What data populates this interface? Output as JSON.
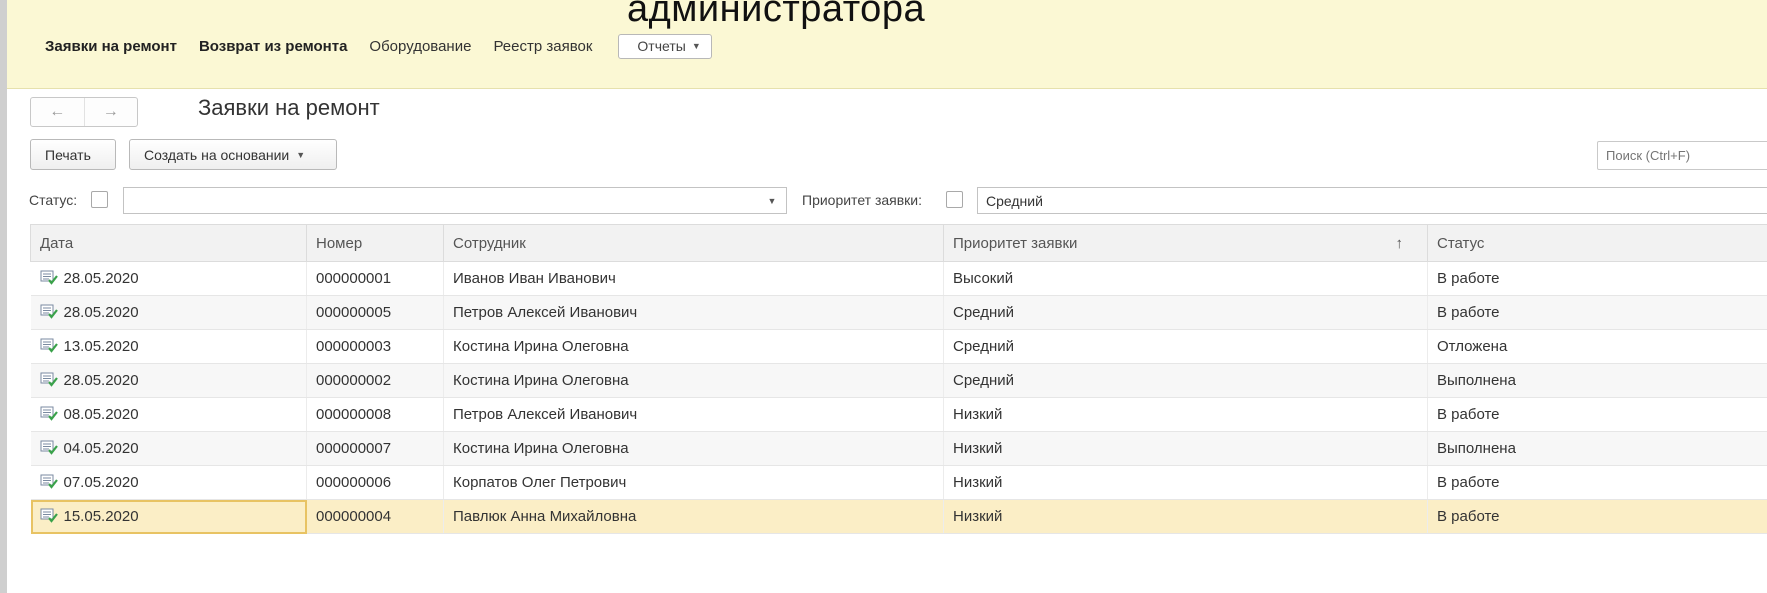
{
  "overlay_title": "администратора",
  "nav": {
    "items": [
      "Заявки на ремонт",
      "Возврат из ремонта",
      "Оборудование",
      "Реестр заявок"
    ],
    "reports": "Отчеты"
  },
  "navigation": {
    "back": "←",
    "forward": "→"
  },
  "page_title": "Заявки на ремонт",
  "toolbar": {
    "print": "Печать",
    "create_based_on": "Создать на основании"
  },
  "search": {
    "placeholder": "Поиск (Ctrl+F)"
  },
  "filters": {
    "status_label": "Статус:",
    "status_value": "",
    "priority_label": "Приоритет заявки:",
    "priority_value": "Средний"
  },
  "table": {
    "columns": [
      "Дата",
      "Номер",
      "Сотрудник",
      "Приоритет заявки",
      "Статус"
    ],
    "sort_indicator": "↑",
    "rows": [
      {
        "date": "28.05.2020",
        "number": "000000001",
        "employee": "Иванов Иван Иванович",
        "priority": "Высокий",
        "status": "В работе"
      },
      {
        "date": "28.05.2020",
        "number": "000000005",
        "employee": "Петров Алексей Иванович",
        "priority": "Средний",
        "status": "В работе"
      },
      {
        "date": "13.05.2020",
        "number": "000000003",
        "employee": "Костина Ирина Олеговна",
        "priority": "Средний",
        "status": "Отложена"
      },
      {
        "date": "28.05.2020",
        "number": "000000002",
        "employee": "Костина Ирина Олеговна",
        "priority": "Средний",
        "status": "Выполнена"
      },
      {
        "date": "08.05.2020",
        "number": "000000008",
        "employee": "Петров Алексей Иванович",
        "priority": "Низкий",
        "status": "В работе"
      },
      {
        "date": "04.05.2020",
        "number": "000000007",
        "employee": "Костина Ирина Олеговна",
        "priority": "Низкий",
        "status": "Выполнена"
      },
      {
        "date": "07.05.2020",
        "number": "000000006",
        "employee": "Корпатов Олег Петрович",
        "priority": "Низкий",
        "status": "В работе"
      },
      {
        "date": "15.05.2020",
        "number": "000000004",
        "employee": "Павлюк Анна Михайловна",
        "priority": "Низкий",
        "status": "В работе"
      }
    ]
  },
  "colors": {
    "topbar_bg": "#fbf8d4",
    "selected_row": "#fbeec6",
    "doc_icon_green": "#3aa14a"
  },
  "icons": {
    "row_icon": "document-check-icon"
  }
}
